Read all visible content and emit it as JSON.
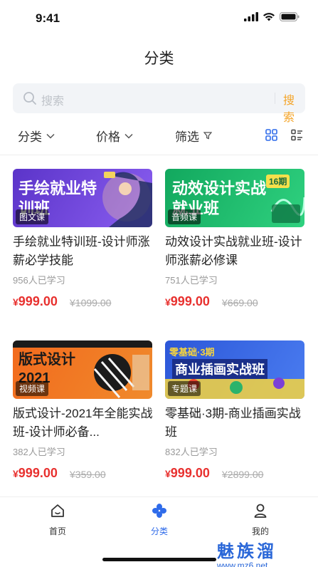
{
  "status_bar": {
    "time": "9:41"
  },
  "page": {
    "title": "分类"
  },
  "search": {
    "placeholder": "搜索",
    "button_label": "搜索"
  },
  "filters": {
    "category_label": "分类",
    "price_label": "价格",
    "filter_label": "筛选"
  },
  "courses": [
    {
      "thumb_title": "手绘就业特训班",
      "thumb_tag": "图文课",
      "title": "手绘就业特训班-设计师涨薪必学技能",
      "learners": "956人已学习",
      "price": "999.00",
      "old_price": "¥1099.00",
      "colors": {
        "bg": "#6a3fd4",
        "accent": "#f3d35c"
      }
    },
    {
      "thumb_title": "动效设计实战就业班",
      "thumb_tag": "音频课",
      "thumb_badge": "16期",
      "title": "动效设计实战就业班-设计师涨薪必修课",
      "learners": "751人已学习",
      "price": "999.00",
      "old_price": "¥669.00",
      "colors": {
        "bg": "#19b86a",
        "accent": "#f6e04b"
      }
    },
    {
      "thumb_title": "版式设计2021",
      "thumb_tag": "视频课",
      "title": "版式设计-2021年全能实战班-设计师必备...",
      "learners": "382人已学习",
      "price": "999.00",
      "old_price": "¥359.00",
      "colors": {
        "bg": "#f06a1c",
        "accent": "#111111"
      }
    },
    {
      "thumb_title": "商业插画实战班",
      "thumb_tag": "专题课",
      "thumb_badge": "零基础·3期",
      "title": "零基础·3期-商业插画实战班",
      "learners": "832人已学习",
      "price": "999.00",
      "old_price": "¥2899.00",
      "colors": {
        "bg": "#2f5fe0",
        "accent": "#f7d53d"
      }
    }
  ],
  "currency": "¥",
  "tabs": [
    {
      "label": "首页",
      "icon": "home-icon",
      "active": false
    },
    {
      "label": "分类",
      "icon": "category-icon",
      "active": true
    },
    {
      "label": "我的",
      "icon": "profile-icon",
      "active": false
    }
  ],
  "watermark": {
    "main": "魅族溜",
    "sub": "www.mz6.net"
  },
  "theme": {
    "accent_blue": "#2f6bea",
    "price_red": "#e8312f",
    "search_orange": "#f4a52a"
  }
}
